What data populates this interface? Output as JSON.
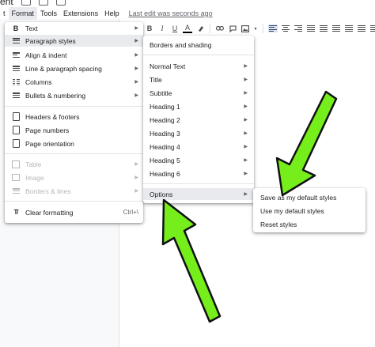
{
  "title": {
    "text": "ent"
  },
  "menubar": {
    "items": [
      "t",
      "Format",
      "Tools",
      "Extensions",
      "Help"
    ],
    "active_index": 1,
    "last_edit": "Last edit was seconds ago"
  },
  "toolbar": {
    "bold": "B",
    "italic": "I",
    "underline": "U",
    "text_color": "A"
  },
  "format_menu": {
    "items": [
      {
        "label": "Text",
        "icon": "bold-icon",
        "submenu": true
      },
      {
        "label": "Paragraph styles",
        "icon": "paragraph-icon",
        "submenu": true
      },
      {
        "label": "Align & indent",
        "icon": "align-icon",
        "submenu": true
      },
      {
        "label": "Line & paragraph spacing",
        "icon": "line-spacing-icon",
        "submenu": true
      },
      {
        "label": "Columns",
        "icon": "columns-icon",
        "submenu": true
      },
      {
        "label": "Bullets & numbering",
        "icon": "bullets-icon",
        "submenu": true
      },
      {
        "label": "Headers & footers",
        "icon": "header-icon",
        "submenu": false
      },
      {
        "label": "Page numbers",
        "icon": "page-number-icon",
        "submenu": false
      },
      {
        "label": "Page orientation",
        "icon": "page-orientation-icon",
        "submenu": false
      },
      {
        "label": "Table",
        "icon": "table-icon",
        "submenu": true,
        "disabled": true
      },
      {
        "label": "Image",
        "icon": "image-icon",
        "submenu": true,
        "disabled": true
      },
      {
        "label": "Borders & lines",
        "icon": "borders-icon",
        "submenu": true,
        "disabled": true
      },
      {
        "label": "Clear formatting",
        "icon": "clear-formatting-icon",
        "shortcut": "Ctrl+\\"
      }
    ]
  },
  "paragraph_menu": {
    "borders": "Borders and shading",
    "styles": [
      "Normal Text",
      "Title",
      "Subtitle",
      "Heading 1",
      "Heading 2",
      "Heading 3",
      "Heading 4",
      "Heading 5",
      "Heading 6"
    ],
    "options": "Options"
  },
  "options_menu": {
    "items": [
      "Save as my default styles",
      "Use my default styles",
      "Reset styles"
    ]
  },
  "colors": {
    "arrow_fill": "#76ee1c",
    "arrow_stroke": "#111111",
    "menu_highlight": "#e8eaed"
  }
}
